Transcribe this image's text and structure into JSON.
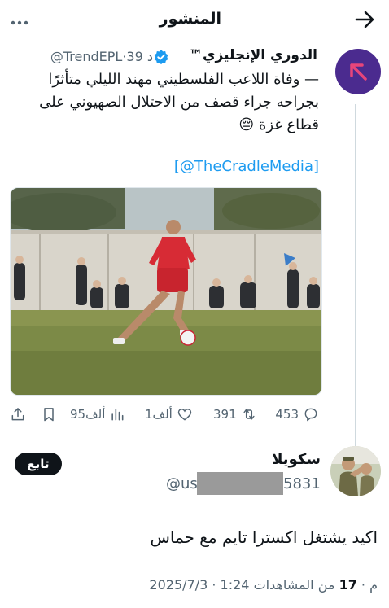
{
  "header": {
    "title": "المنشور"
  },
  "tweet": {
    "account_name": "الدوري الإنجليزي™",
    "handle": "@TrendEPL",
    "time": "39 د",
    "separator": "·",
    "text": "— وفاة اللاعب الفلسطيني مهند الليلي متأثرًا بجراحه جراء قصف من الاحتلال الصهيوني على قطاع غزة 😔",
    "mention": "[@TheCradleMedia]"
  },
  "actions": {
    "replies": "453",
    "retweets": "391",
    "likes": "1ألف",
    "views": "95ألف"
  },
  "reply": {
    "name": "سكويلا",
    "handle_start": "@us",
    "handle_end": "5831",
    "follow_label": "تابع",
    "text": "اكيد يشتغل اكسترا تايم مع حماس",
    "timestamp": "2025/7/3 · 1:24 م ·",
    "views_count": "17",
    "views_label": "من المشاهدات"
  },
  "colors": {
    "accent": "#1d9bf0",
    "verified": "#1d9bf0",
    "avatar_bg": "#4b2b8f",
    "avatar_arrow": "#e8457a",
    "text_primary": "#0f1419",
    "text_secondary": "#536471"
  }
}
